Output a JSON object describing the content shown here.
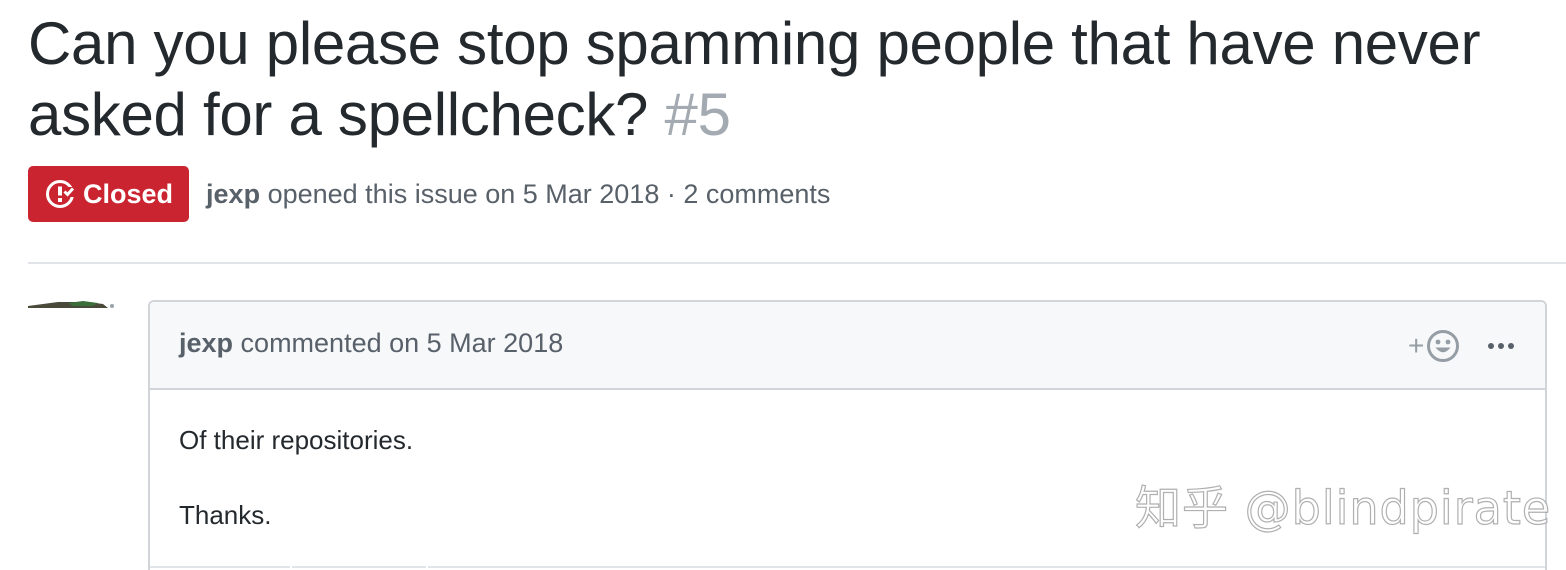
{
  "issue": {
    "title": "Can you please stop spamming people that have never asked for a spellcheck?",
    "number": "#5",
    "state": "Closed",
    "state_color": "#cb2431",
    "state_icon": "issue-closed-icon",
    "author": "jexp",
    "opened_text": "opened this issue on 5 Mar 2018",
    "separator": "·",
    "comments_count": "2 comments"
  },
  "comment": {
    "author": "jexp",
    "action_text": "commented on 5 Mar 2018",
    "reaction_icon": "add-reaction-smiley-icon",
    "reaction_plus": "+",
    "more_icon": "kebab-horizontal-icon",
    "body": [
      "Of their repositories.",
      "Thanks."
    ]
  },
  "watermark": {
    "text": "知乎 @blindpirate"
  }
}
